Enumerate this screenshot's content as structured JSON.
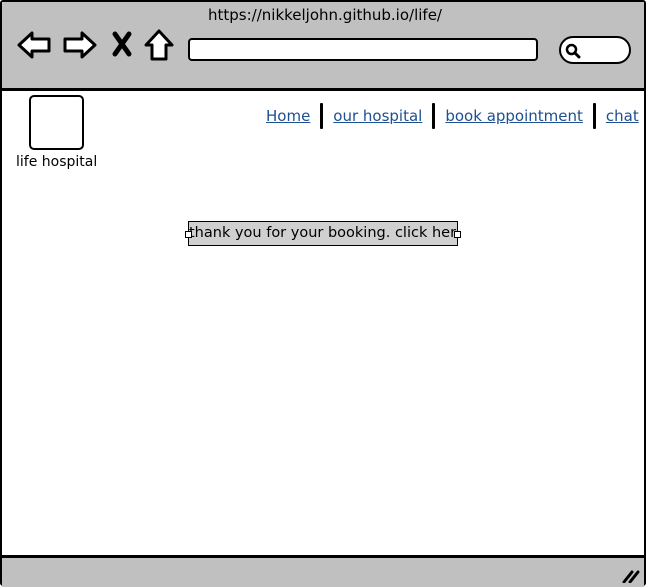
{
  "browser": {
    "url": "https://nikkeljohn.github.io/life/",
    "icons": [
      "back-arrow-icon",
      "forward-arrow-icon",
      "close-icon",
      "home-icon",
      "search-icon",
      "resize-grip-icon"
    ]
  },
  "site": {
    "logo_label": "life hospital",
    "nav": [
      {
        "label": "Home"
      },
      {
        "label": "our hospital"
      },
      {
        "label": "book appointment"
      },
      {
        "label": "chat"
      }
    ]
  },
  "main": {
    "message": "thank you for your booking. click here"
  },
  "colors": {
    "chrome": "#c0c0c0",
    "link": "#1d4f91",
    "message_bg": "#d0d0d0"
  }
}
